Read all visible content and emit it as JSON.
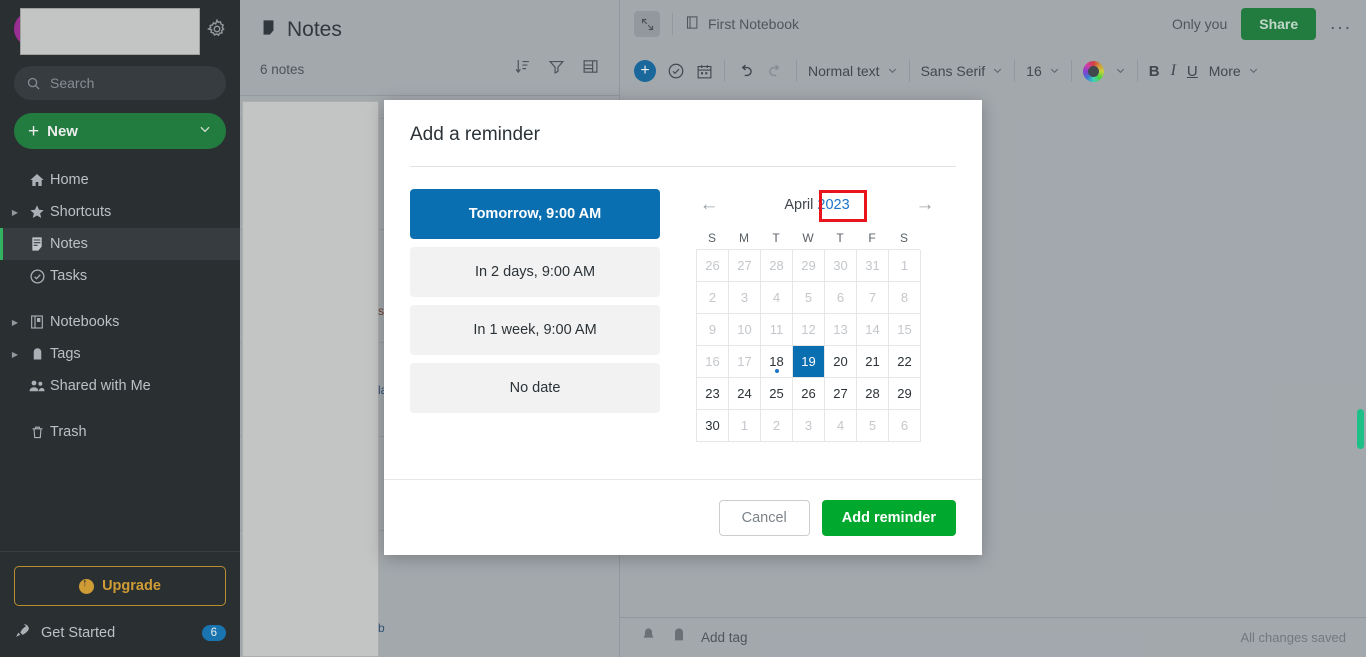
{
  "sidebar": {
    "search_placeholder": "Search",
    "new_label": "New",
    "items": [
      {
        "label": "Home",
        "icon": "home-icon",
        "twisty": false,
        "active": false
      },
      {
        "label": "Shortcuts",
        "icon": "star-icon",
        "twisty": true,
        "active": false
      },
      {
        "label": "Notes",
        "icon": "note-icon",
        "twisty": false,
        "active": true
      },
      {
        "label": "Tasks",
        "icon": "check-circle-icon",
        "twisty": false,
        "active": false
      },
      {
        "label": "Notebooks",
        "icon": "notebook-icon",
        "twisty": true,
        "active": false
      },
      {
        "label": "Tags",
        "icon": "tag-icon",
        "twisty": true,
        "active": false
      },
      {
        "label": "Shared with Me",
        "icon": "people-icon",
        "twisty": false,
        "active": false
      },
      {
        "label": "Trash",
        "icon": "trash-icon",
        "twisty": false,
        "active": false
      }
    ],
    "upgrade_label": "Upgrade",
    "get_started_label": "Get Started",
    "get_started_badge": "6"
  },
  "notelist": {
    "title": "Notes",
    "count": "6 notes",
    "fragments": [
      "st",
      "la",
      "b"
    ]
  },
  "editor": {
    "breadcrumb": "First Notebook",
    "only_you": "Only you",
    "share_label": "Share",
    "more_label": "...",
    "toolbar": {
      "paragraph_style": "Normal text",
      "font_family": "Sans Serif",
      "font_size": "16",
      "bold": "B",
      "italic": "I",
      "underline": "U",
      "more": "More"
    },
    "footer": {
      "add_tag": "Add tag",
      "status": "All changes saved"
    }
  },
  "modal": {
    "title": "Add a reminder",
    "quick_options": [
      {
        "label": "Tomorrow, 9:00 AM",
        "selected": true
      },
      {
        "label": "In 2 days, 9:00 AM",
        "selected": false
      },
      {
        "label": "In 1 week, 9:00 AM",
        "selected": false
      },
      {
        "label": "No date",
        "selected": false
      }
    ],
    "calendar": {
      "month": "April",
      "year": "2023",
      "prev_label": "←",
      "next_label": "→",
      "day_headers": [
        "S",
        "M",
        "T",
        "W",
        "T",
        "F",
        "S"
      ],
      "weeks": [
        [
          {
            "d": "26",
            "out": true
          },
          {
            "d": "27",
            "out": true
          },
          {
            "d": "28",
            "out": true
          },
          {
            "d": "29",
            "out": true
          },
          {
            "d": "30",
            "out": true
          },
          {
            "d": "31",
            "out": true
          },
          {
            "d": "1",
            "out": true
          }
        ],
        [
          {
            "d": "2",
            "out": true
          },
          {
            "d": "3",
            "out": true
          },
          {
            "d": "4",
            "out": true
          },
          {
            "d": "5",
            "out": true
          },
          {
            "d": "6",
            "out": true
          },
          {
            "d": "7",
            "out": true
          },
          {
            "d": "8",
            "out": true
          }
        ],
        [
          {
            "d": "9",
            "out": true
          },
          {
            "d": "10",
            "out": true
          },
          {
            "d": "11",
            "out": true
          },
          {
            "d": "12",
            "out": true
          },
          {
            "d": "13",
            "out": true
          },
          {
            "d": "14",
            "out": true
          },
          {
            "d": "15",
            "out": true
          }
        ],
        [
          {
            "d": "16",
            "out": true
          },
          {
            "d": "17",
            "out": true
          },
          {
            "d": "18",
            "out": false,
            "dot": true
          },
          {
            "d": "19",
            "out": false,
            "today": true
          },
          {
            "d": "20",
            "out": false
          },
          {
            "d": "21",
            "out": false
          },
          {
            "d": "22",
            "out": false
          }
        ],
        [
          {
            "d": "23",
            "out": false
          },
          {
            "d": "24",
            "out": false
          },
          {
            "d": "25",
            "out": false
          },
          {
            "d": "26",
            "out": false
          },
          {
            "d": "27",
            "out": false
          },
          {
            "d": "28",
            "out": false
          },
          {
            "d": "29",
            "out": false
          }
        ],
        [
          {
            "d": "30",
            "out": false
          },
          {
            "d": "1",
            "out": true
          },
          {
            "d": "2",
            "out": true
          },
          {
            "d": "3",
            "out": true
          },
          {
            "d": "4",
            "out": true
          },
          {
            "d": "5",
            "out": true
          },
          {
            "d": "6",
            "out": true
          }
        ]
      ]
    },
    "cancel_label": "Cancel",
    "confirm_label": "Add reminder"
  },
  "colors": {
    "accent_green": "#00a82d",
    "accent_blue": "#0a6fb0",
    "highlight_red": "#e8151d",
    "upgrade_gold": "#e0a32e"
  }
}
